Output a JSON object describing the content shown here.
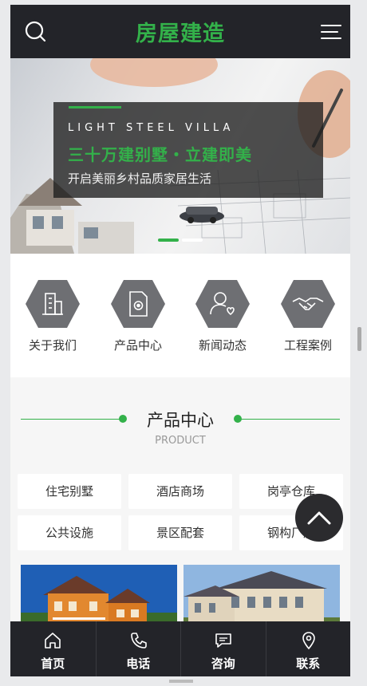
{
  "header": {
    "logo_text": "房屋建造",
    "search_icon": "search-icon",
    "menu_icon": "menu-icon",
    "accent_color": "#33b14a",
    "bg_color": "#232429"
  },
  "banner": {
    "subtitle": "LIGHT STEEL VILLA",
    "title": "三十万建别墅・立建即美",
    "description": "开启美丽乡村品质家居生活",
    "slide_count": 2,
    "active_slide": 1
  },
  "nav": {
    "items": [
      {
        "label": "关于我们",
        "icon": "building-icon"
      },
      {
        "label": "产品中心",
        "icon": "document-gear-icon"
      },
      {
        "label": "新闻动态",
        "icon": "user-heart-icon"
      },
      {
        "label": "工程案例",
        "icon": "handshake-icon"
      }
    ]
  },
  "products": {
    "title": "产品中心",
    "subtitle": "PRODUCT",
    "categories": [
      "住宅别墅",
      "酒店商场",
      "岗亭仓库",
      "公共设施",
      "景区配套",
      "钢构厂房"
    ]
  },
  "bottom_nav": {
    "items": [
      {
        "label": "首页",
        "icon": "home-icon"
      },
      {
        "label": "电话",
        "icon": "phone-icon"
      },
      {
        "label": "咨询",
        "icon": "chat-icon"
      },
      {
        "label": "联系",
        "icon": "location-icon"
      }
    ]
  },
  "back_to_top_icon": "chevron-up-icon"
}
